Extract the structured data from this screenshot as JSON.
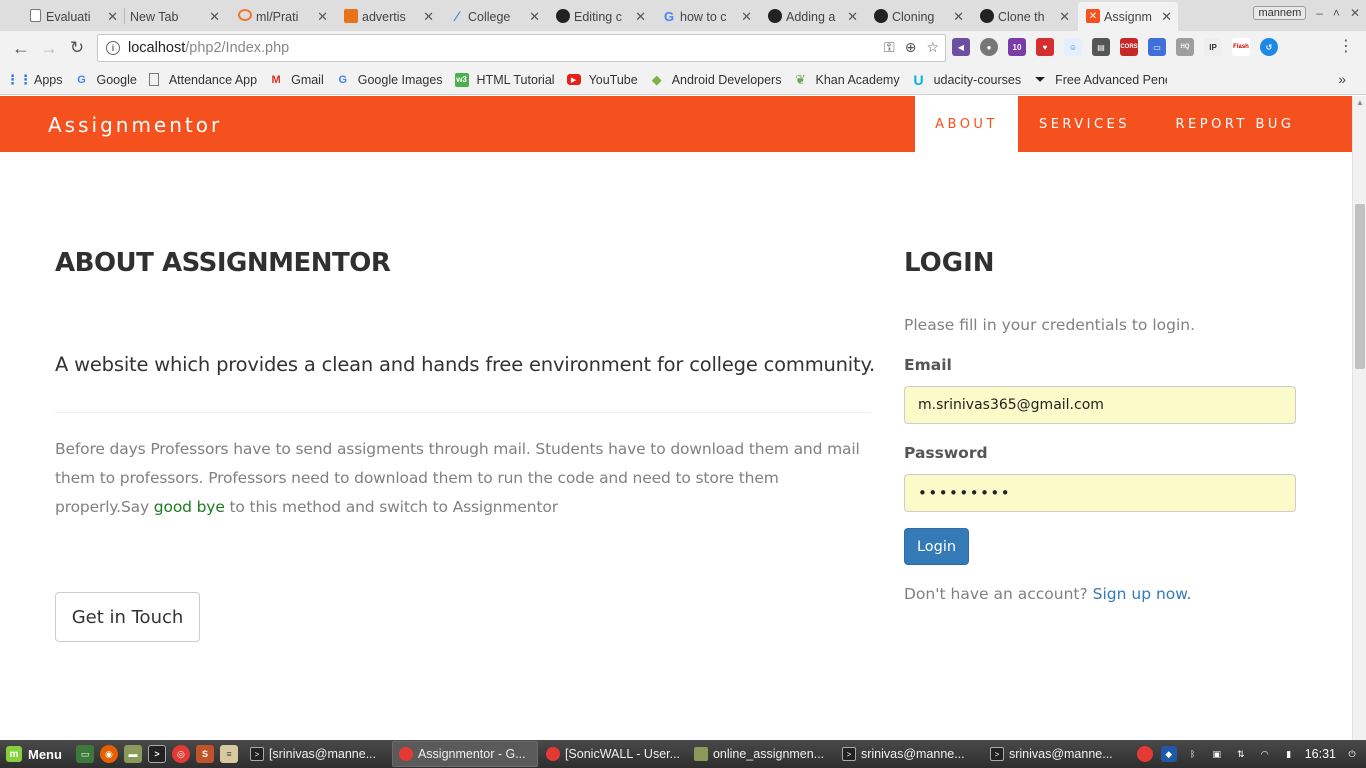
{
  "browser": {
    "tabs": [
      {
        "title": "Evaluati",
        "icon": "document-icon"
      },
      {
        "title": "New Tab",
        "icon": "none"
      },
      {
        "title": "ml/Prati",
        "icon": "jupyter-icon"
      },
      {
        "title": "advertis",
        "icon": "book-icon"
      },
      {
        "title": "College",
        "icon": "pen-icon"
      },
      {
        "title": "Editing c",
        "icon": "github-icon"
      },
      {
        "title": "how to c",
        "icon": "google-icon"
      },
      {
        "title": "Adding a",
        "icon": "github-icon"
      },
      {
        "title": "Cloning",
        "icon": "github-icon"
      },
      {
        "title": "Clone th",
        "icon": "github-icon"
      },
      {
        "title": "Assignm",
        "icon": "assignmentor-icon"
      }
    ],
    "profile_name": "mannem",
    "url_host": "localhost",
    "url_path": "/php2/Index.php",
    "bookmarks": [
      {
        "label": "Apps",
        "icon": "apps-grid-icon"
      },
      {
        "label": "Google",
        "icon": "google-icon"
      },
      {
        "label": "Attendance App",
        "icon": "page-icon"
      },
      {
        "label": "Gmail",
        "icon": "gmail-icon"
      },
      {
        "label": "Google Images",
        "icon": "google-icon"
      },
      {
        "label": "HTML Tutorial",
        "icon": "w3-icon"
      },
      {
        "label": "YouTube",
        "icon": "youtube-icon"
      },
      {
        "label": "Android Developers",
        "icon": "android-icon"
      },
      {
        "label": "Khan Academy",
        "icon": "leaf-icon"
      },
      {
        "label": "udacity-courses",
        "icon": "udacity-icon"
      },
      {
        "label": "Free Advanced Pene",
        "icon": "pentest-icon"
      }
    ]
  },
  "site": {
    "brand": "Assignmentor",
    "nav": [
      {
        "label": "ABOUT",
        "active": true
      },
      {
        "label": "SERVICES",
        "active": false
      },
      {
        "label": "REPORT BUG",
        "active": false
      }
    ],
    "about": {
      "title": "ABOUT ASSIGNMENTOR",
      "lead": "A website which provides a clean and hands free environment for college community.",
      "body_before": "Before days Professors have to send assigments through mail. Students have to download them and mail them to professors. Professors need to download them to run the code and need to store them properly.Say ",
      "body_highlight": "good bye",
      "body_after": " to this method and switch to Assignmentor",
      "cta": "Get in Touch"
    },
    "login": {
      "title": "LOGIN",
      "hint": "Please fill in your credentials to login.",
      "email_label": "Email",
      "email_value": "m.srinivas365@gmail.com",
      "password_label": "Password",
      "password_value": "•••••••••",
      "submit": "Login",
      "signup_prompt": "Don't have an account?",
      "signup_link": "Sign up now."
    },
    "colors": {
      "brand_orange": "#f4511e",
      "button_blue": "#337ab7",
      "autofill_yellow": "#fafbc8"
    }
  },
  "taskbar": {
    "menu_label": "Menu",
    "tasks": [
      {
        "label": "[srinivas@manne...",
        "icon": "terminal-icon"
      },
      {
        "label": "Assignmentor - G...",
        "icon": "chrome-icon",
        "active": true
      },
      {
        "label": "[SonicWALL - User...",
        "icon": "chrome-icon"
      },
      {
        "label": "online_assignmen...",
        "icon": "folder-icon"
      },
      {
        "label": "srinivas@manne...",
        "icon": "terminal-icon"
      },
      {
        "label": "srinivas@manne...",
        "icon": "terminal-icon"
      }
    ],
    "clock": "16:31"
  }
}
